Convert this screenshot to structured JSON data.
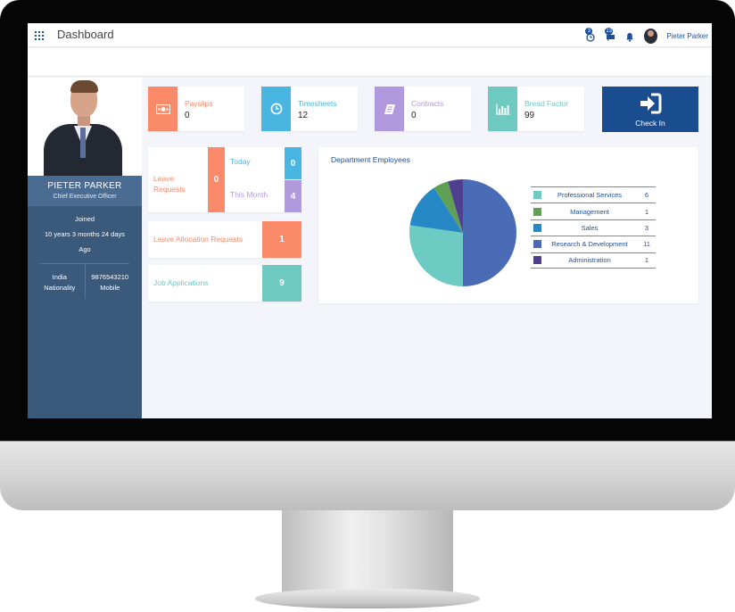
{
  "topbar": {
    "title": "Dashboard",
    "clock_badge": "3",
    "chat_badge": "13",
    "user_name": "Pieter Parker"
  },
  "profile": {
    "name": "PIETER PARKER",
    "role": "Chief Executive Officer",
    "joined_label": "Joined",
    "joined_duration": "10 years 3 months 24 days",
    "joined_suffix": "Ago",
    "country": "India",
    "country_label": "Nationality",
    "phone": "9876543210",
    "phone_label": "Mobile"
  },
  "stats": [
    {
      "label": "Payslips",
      "value": "0",
      "color": "#fa8a6a",
      "icon": "money-icon"
    },
    {
      "label": "Timesheets",
      "value": "12",
      "color": "#49b6e2",
      "icon": "clock-icon"
    },
    {
      "label": "Contracts",
      "value": "0",
      "color": "#b199dd",
      "icon": "document-icon"
    },
    {
      "label": "Bread Factor",
      "value": "99",
      "color": "#6ec9c1",
      "icon": "bar-chart-icon"
    }
  ],
  "checkin": {
    "label": "Check In",
    "color": "#1a4d8f",
    "icon": "sign-in-icon"
  },
  "leave_requests": {
    "title_line1": "Leave",
    "title_line2": "Requests",
    "total": "0",
    "today_label": "Today",
    "today_value": "0",
    "month_label": "This Month",
    "month_value": "4"
  },
  "leave_allocation": {
    "label": "Leave Allocation Requests",
    "value": "1"
  },
  "job_applications": {
    "label": "Job Applications",
    "value": "9"
  },
  "department": {
    "title": "Department Employees"
  },
  "chart_data": {
    "type": "pie",
    "title": "Department Employees",
    "categories": [
      "Professional Services",
      "Management",
      "Sales",
      "Research & Development",
      "Administration"
    ],
    "values": [
      6,
      1,
      3,
      11,
      1
    ],
    "colors": [
      "#6ecbc4",
      "#5fa055",
      "#2688c4",
      "#4a6bb5",
      "#503f8f"
    ]
  }
}
